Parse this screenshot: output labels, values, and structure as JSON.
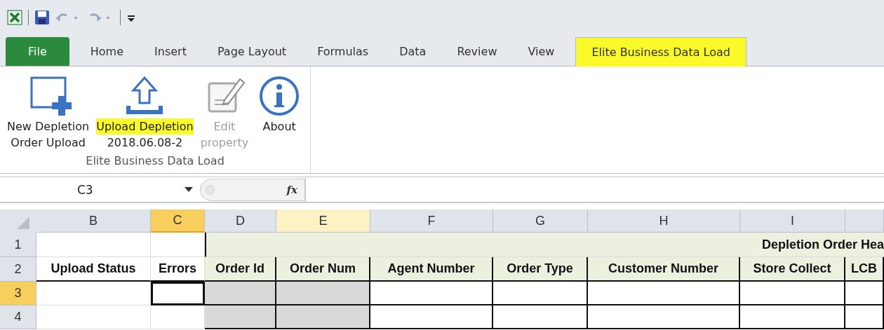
{
  "quick_access": [
    {
      "kind": "excel"
    },
    {
      "kind": "save"
    },
    {
      "kind": "undo",
      "disabled": true
    },
    {
      "kind": "redo",
      "disabled": true
    },
    {
      "kind": "customize"
    }
  ],
  "tabs": [
    {
      "label": "File",
      "kind": "file",
      "selected": false,
      "highlighted": false
    },
    {
      "label": "Home",
      "kind": "tab",
      "selected": false,
      "highlighted": false
    },
    {
      "label": "Insert",
      "kind": "tab",
      "selected": false,
      "highlighted": false
    },
    {
      "label": "Page Layout",
      "kind": "tab",
      "selected": false,
      "highlighted": false
    },
    {
      "label": "Formulas",
      "kind": "tab",
      "selected": false,
      "highlighted": false
    },
    {
      "label": "Data",
      "kind": "tab",
      "selected": false,
      "highlighted": false
    },
    {
      "label": "Review",
      "kind": "tab",
      "selected": false,
      "highlighted": false
    },
    {
      "label": "View",
      "kind": "tab",
      "selected": false,
      "highlighted": false
    },
    {
      "label": "Elite Business Data Load",
      "kind": "tab",
      "selected": true,
      "highlighted": true
    }
  ],
  "ribbon": {
    "group_label": "Elite Business Data Load",
    "buttons": [
      {
        "kind": "new",
        "lines": [
          "New Depletion",
          "Order Upload"
        ],
        "disabled": false,
        "highlighted": false
      },
      {
        "kind": "upload",
        "lines": [
          "Upload Depletion",
          "2018.06.08-2"
        ],
        "disabled": false,
        "highlighted": true
      },
      {
        "kind": "edit",
        "lines": [
          "Edit",
          "property"
        ],
        "disabled": true,
        "highlighted": false
      },
      {
        "kind": "about",
        "lines": [
          "About"
        ],
        "disabled": false,
        "highlighted": false
      }
    ]
  },
  "formula_bar": {
    "name_box": "C3",
    "fx_label": "fx"
  },
  "sheet": {
    "columns": [
      {
        "letter": "B",
        "selected": false,
        "hovered": false,
        "shaded": false,
        "heading": "Upload Status"
      },
      {
        "letter": "C",
        "selected": true,
        "hovered": false,
        "shaded": false,
        "heading": "Errors"
      },
      {
        "letter": "D",
        "selected": false,
        "hovered": false,
        "shaded": true,
        "heading": "Order Id"
      },
      {
        "letter": "E",
        "selected": false,
        "hovered": true,
        "shaded": true,
        "heading": "Order Num"
      },
      {
        "letter": "F",
        "selected": false,
        "hovered": false,
        "shaded": false,
        "heading": "Agent Number"
      },
      {
        "letter": "G",
        "selected": false,
        "hovered": false,
        "shaded": false,
        "heading": "Order Type"
      },
      {
        "letter": "H",
        "selected": false,
        "hovered": false,
        "shaded": false,
        "heading": "Customer Number"
      },
      {
        "letter": "I",
        "selected": false,
        "hovered": false,
        "shaded": false,
        "heading": "Store Collect"
      },
      {
        "selected": false,
        "hovered": false,
        "shaded": false,
        "heading": "LCB"
      }
    ],
    "banner": "Depletion Order Hea",
    "rows": [
      {
        "number": "1",
        "selected": false,
        "kind": "banner"
      },
      {
        "number": "2",
        "selected": false,
        "kind": "headings"
      },
      {
        "number": "3",
        "selected": true,
        "kind": "data"
      },
      {
        "number": "4",
        "selected": false,
        "kind": "data"
      }
    ]
  }
}
